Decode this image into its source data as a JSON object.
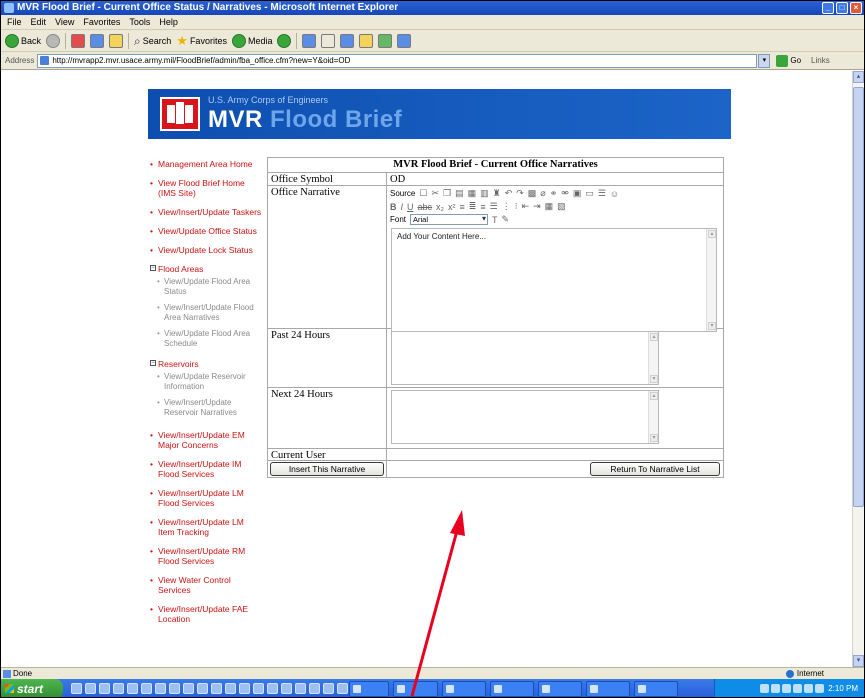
{
  "window": {
    "title": "MVR Flood Brief - Current Office Status / Narratives - Microsoft Internet Explorer"
  },
  "menubar": {
    "items": [
      "File",
      "Edit",
      "View",
      "Favorites",
      "Tools",
      "Help"
    ]
  },
  "toolbar": {
    "back_label": "Back",
    "search_label": "Search",
    "favorites_label": "Favorites",
    "media_label": "Media"
  },
  "addressbar": {
    "label": "Address",
    "url": "http://mvrapp2.mvr.usace.army.mil/FloodBrief/admin/fba_office.cfm?new=Y&oid=OD",
    "go_label": "Go",
    "links_label": "Links"
  },
  "banner": {
    "agency": "U.S. Army Corps of Engineers",
    "brand_mvr": "MVR",
    "brand_flood": "Flood",
    "brand_brief": "Brief"
  },
  "nav": {
    "items_top": [
      "Management Area Home",
      "View Flood Brief Home (IMS Site)",
      "View/Insert/Update Taskers",
      "View/Update Office Status",
      "View/Update Lock Status"
    ],
    "flood_areas": {
      "label": "Flood Areas",
      "subs": [
        "View/Update Flood Area Status",
        "View/Insert/Update Flood Area Narratives",
        "View/Update Flood Area Schedule"
      ]
    },
    "reservoirs": {
      "label": "Reservoirs",
      "subs": [
        "View/Update Reservoir Information",
        "View/Insert/Update Reservoir Narratives"
      ]
    },
    "items_bottom": [
      "View/Insert/Update EM Major Concerns",
      "View/Insert/Update IM Flood Services",
      "View/Insert/Update LM Flood Services",
      "View/Insert/Update LM Item Tracking",
      "View/Insert/Update RM Flood Services",
      "View Water Control Services",
      "View/Insert/Update FAE Location"
    ]
  },
  "form": {
    "title": "MVR Flood Brief - Current Office Narratives",
    "office_symbol_label": "Office Symbol",
    "office_symbol_value": "OD",
    "office_narrative_label": "Office Narrative",
    "editor": {
      "source_label": "Source",
      "font_label": "Font",
      "font_value": "Arial",
      "content": "Add Your Content Here..."
    },
    "past24_label": "Past 24 Hours",
    "next24_label": "Next 24 Hours",
    "current_user_label": "Current User",
    "current_user_value": "",
    "insert_button": "Insert This Narrative",
    "return_button": "Return To Narrative List"
  },
  "statusbar": {
    "status": "Done",
    "zone": "Internet"
  },
  "taskbar": {
    "start_label": "start",
    "clock": "2:10 PM"
  },
  "colors": {
    "nav_link": "#cc1111",
    "banner_blue": "#1456bd",
    "annotation_arrow": "#e8001e"
  }
}
